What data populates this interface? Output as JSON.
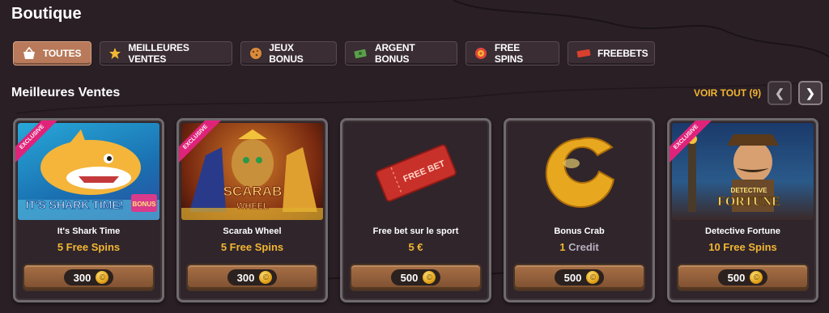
{
  "page": {
    "title": "Boutique"
  },
  "tabs": [
    {
      "label": "TOUTES",
      "icon": "basket-icon",
      "active": true
    },
    {
      "label": "MEILLEURES VENTES",
      "icon": "star-icon",
      "active": false
    },
    {
      "label": "JEUX BONUS",
      "icon": "cookie-icon",
      "active": false
    },
    {
      "label": "ARGENT BONUS",
      "icon": "cash-icon",
      "active": false
    },
    {
      "label": "FREE SPINS",
      "icon": "spin-token-icon",
      "active": false
    },
    {
      "label": "FREEBETS",
      "icon": "ticket-icon",
      "active": false
    }
  ],
  "section": {
    "title": "Meilleures Ventes",
    "see_all": "VOIR TOUT (9)"
  },
  "cards": [
    {
      "name": "It's Shark Time",
      "value": "5 Free Spins",
      "price": "300",
      "badge": "EXCLUSIVE",
      "art_text": "IT'S SHARK TIME!",
      "art_badge": "BONUS"
    },
    {
      "name": "Scarab Wheel",
      "value": "5 Free Spins",
      "price": "300",
      "badge": "EXCLUSIVE",
      "art_text": "SCARAB",
      "art_sub": "WHEEL"
    },
    {
      "name": "Free bet sur le sport",
      "value": "5 €",
      "price": "500",
      "art_text": "FREE BET"
    },
    {
      "name": "Bonus Crab",
      "value_number": "1",
      "value_unit": "Credit",
      "price": "500"
    },
    {
      "name": "Detective Fortune",
      "value": "10 Free Spins",
      "price": "500",
      "badge": "EXCLUSIVE",
      "art_top": "DETECTIVE",
      "art_text": "FORTUNE"
    }
  ],
  "colors": {
    "accent": "#f2b632",
    "active_tab": "#b87a5a",
    "background": "#2a1f25"
  }
}
